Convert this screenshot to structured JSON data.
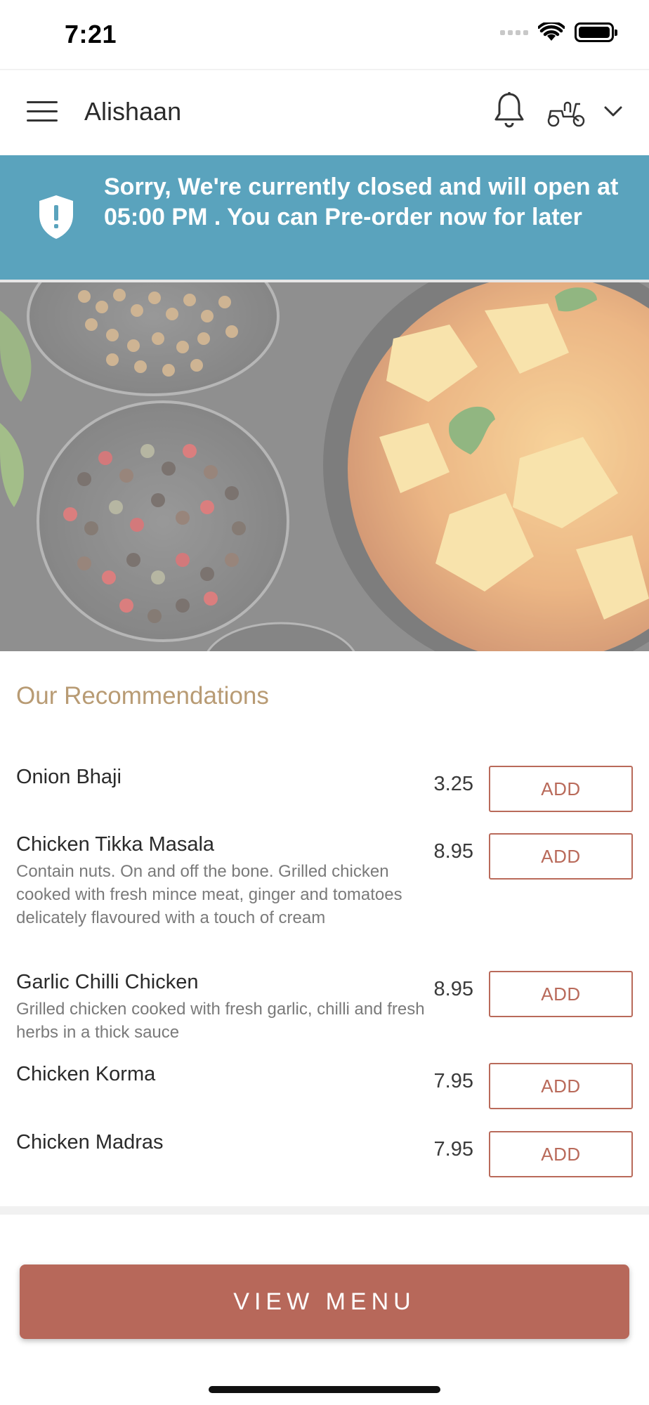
{
  "status_bar": {
    "time": "7:21"
  },
  "header": {
    "title": "Alishaan",
    "icons": [
      "menu-icon",
      "bell-icon",
      "scooter-icon",
      "chevron-down-icon"
    ]
  },
  "closed_banner": {
    "message": "Sorry, We're currently closed and will open at 05:00 PM . You can Pre-order now for later",
    "background": "#5aa3bd",
    "icon": "shield-alert-icon"
  },
  "hero": {
    "description": ""
  },
  "recommendations": {
    "title": "Our Recommendations",
    "items": [
      {
        "name": "Onion Bhaji",
        "description": "",
        "price": "3.25",
        "button": "ADD"
      },
      {
        "name": "Chicken Tikka Masala",
        "description": "Contain nuts. On and off the bone. Grilled chicken cooked with fresh mince meat, ginger and tomatoes delicately flavoured with a touch of cream",
        "price": "8.95",
        "button": "ADD"
      },
      {
        "name": "Garlic Chilli Chicken",
        "description": "Grilled chicken cooked with fresh garlic, chilli and fresh herbs in a thick sauce",
        "price": "8.95",
        "button": "ADD"
      },
      {
        "name": "Chicken Korma",
        "description": "",
        "price": "7.95",
        "button": "ADD"
      },
      {
        "name": "Chicken Madras",
        "description": "",
        "price": "7.95",
        "button": "ADD"
      }
    ]
  },
  "colors": {
    "accent": "#b7685a",
    "heading": "#b89b74",
    "banner": "#5aa3bd"
  },
  "footer": {
    "view_menu_label": "VIEW MENU"
  }
}
